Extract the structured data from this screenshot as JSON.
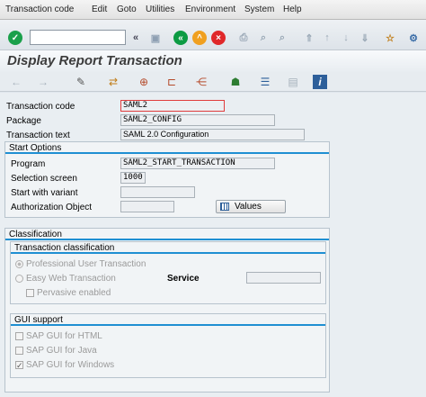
{
  "menu": [
    "Transaction code",
    "Edit",
    "Goto",
    "Utilities",
    "Environment",
    "System",
    "Help"
  ],
  "toolbar": {
    "command_field": "",
    "enter_icon": "green-check-icon",
    "back_icon": "back-icon",
    "exit_icon": "exit-icon",
    "cancel_icon": "cancel-icon",
    "colors": {
      "enter": "#1aa04b",
      "back": "#0c9b43",
      "exit": "#f0a020",
      "cancel": "#e0282a"
    }
  },
  "title": "Display Report Transaction",
  "fields": {
    "transaction_code_label": "Transaction code",
    "transaction_code_value": "SAML2",
    "package_label": "Package",
    "package_value": "SAML2_CONFIG",
    "transaction_text_label": "Transaction text",
    "transaction_text_value": "SAML 2.0 Configuration"
  },
  "start_options": {
    "title": "Start Options",
    "program_label": "Program",
    "program_value": "SAML2_START_TRANSACTION",
    "selection_screen_label": "Selection screen",
    "selection_screen_value": "1000",
    "start_with_variant_label": "Start with variant",
    "start_with_variant_value": "",
    "authorization_object_label": "Authorization Object",
    "authorization_object_value": "",
    "values_button": "Values"
  },
  "classification": {
    "title": "Classification",
    "transaction_classification": {
      "title": "Transaction classification",
      "professional": "Professional User Transaction",
      "easy_web": "Easy Web Transaction",
      "service_label": "Service",
      "service_value": "",
      "pervasive": "Pervasive enabled"
    },
    "gui_support": {
      "title": "GUI support",
      "html": "SAP GUI for HTML",
      "java": "SAP GUI for Java",
      "windows": "SAP GUI for Windows",
      "windows_checked": true
    }
  }
}
